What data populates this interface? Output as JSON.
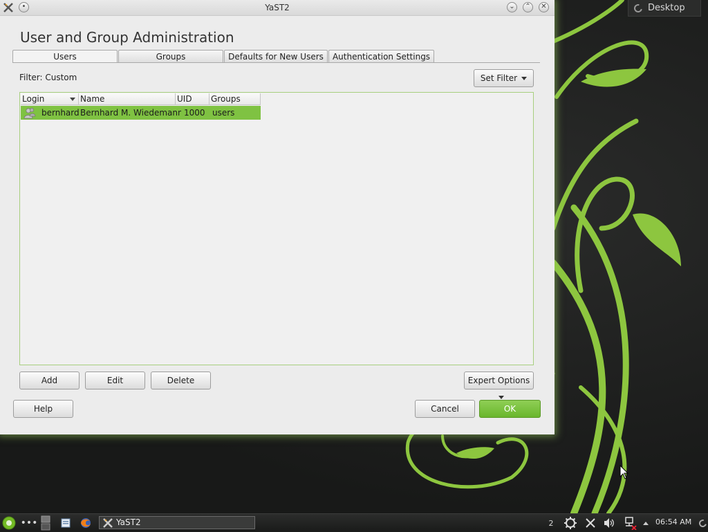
{
  "window": {
    "title": "YaST2",
    "heading": "User and Group Administration"
  },
  "tabs": [
    {
      "label": "Users",
      "active": true
    },
    {
      "label": "Groups",
      "active": false
    },
    {
      "label": "Defaults for New Users",
      "active": false
    },
    {
      "label": "Authentication Settings",
      "active": false
    }
  ],
  "filter": {
    "label": "Filter: Custom",
    "set_filter_label": "Set Filter"
  },
  "table": {
    "columns": [
      "Login",
      "Name",
      "UID",
      "Groups"
    ],
    "rows": [
      {
        "login": "bernhard",
        "name": "Bernhard M. Wiedemann",
        "uid": "1000",
        "groups": "users"
      }
    ]
  },
  "actions": {
    "add_label": "Add",
    "edit_label": "Edit",
    "delete_label": "Delete",
    "expert_options_label": "Expert Options"
  },
  "footer": {
    "help_label": "Help",
    "cancel_label": "Cancel",
    "ok_label": "OK"
  },
  "desktop": {
    "widget_label": "Desktop"
  },
  "taskbar": {
    "task_label": "YaST2",
    "desktop_number": "2",
    "clock": "06:54 AM"
  },
  "colors": {
    "accent": "#7fc242",
    "vine": "#8dc63f",
    "background": "#1b1c1b"
  }
}
